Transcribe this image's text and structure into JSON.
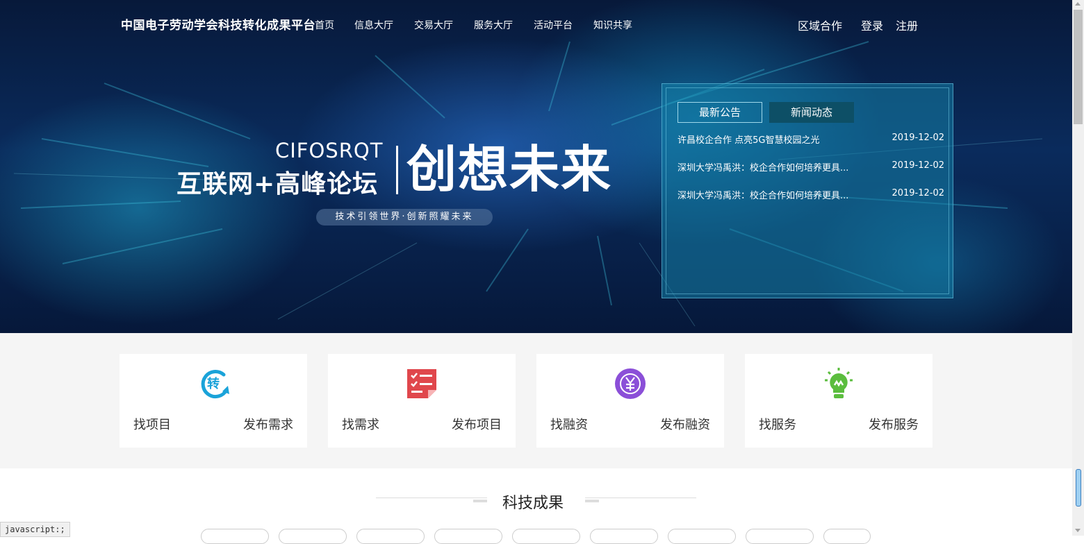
{
  "header": {
    "site_title": "中国电子劳动学会科技转化成果平台",
    "nav": [
      "首页",
      "信息大厅",
      "交易大厅",
      "服务大厅",
      "活动平台",
      "知识共享"
    ],
    "region": "区域合作",
    "login": "登录",
    "register": "注册"
  },
  "banner": {
    "en": "CIFOSRQT",
    "cn": "互联网+高峰论坛",
    "big": "创想未来",
    "slogan": "技术引领世界·创新照耀未来"
  },
  "news": {
    "tabs": [
      "最新公告",
      "新闻动态"
    ],
    "items": [
      {
        "title": "许昌校企合作 点亮5G智慧校园之光",
        "date": "2019-12-02"
      },
      {
        "title": "深圳大学冯禹洪：校企合作如何培养更具...",
        "date": "2019-12-02"
      },
      {
        "title": "深圳大学冯禹洪：校企合作如何培养更具...",
        "date": "2019-12-02"
      }
    ]
  },
  "services": [
    {
      "left": "找项目",
      "right": "发布需求",
      "icon": "transfer-icon",
      "color": "#1aa3d9"
    },
    {
      "left": "找需求",
      "right": "发布项目",
      "icon": "checklist-icon",
      "color": "#e0474c"
    },
    {
      "left": "找融资",
      "right": "发布融资",
      "icon": "yuan-icon",
      "color": "#8b4fd8"
    },
    {
      "left": "找服务",
      "right": "发布服务",
      "icon": "lightbulb-icon",
      "color": "#5bbd3e"
    }
  ],
  "section": {
    "title": "科技成果"
  },
  "status_bar": "javascript:;"
}
